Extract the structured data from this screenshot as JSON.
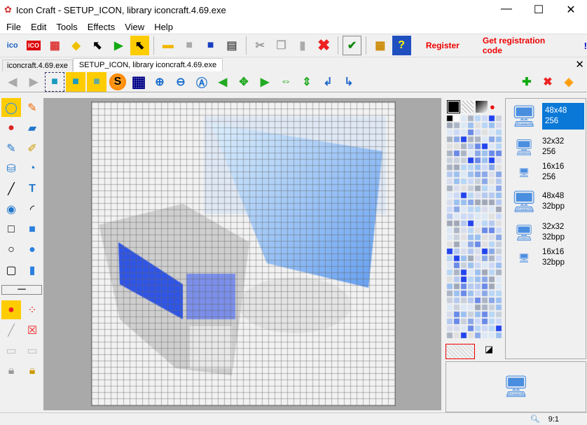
{
  "window": {
    "title": "Icon Craft - SETUP_ICON, library iconcraft.4.69.exe",
    "minimize": "—",
    "maximize": "☐",
    "close": "✕"
  },
  "menu": [
    "File",
    "Edit",
    "Tools",
    "Effects",
    "View",
    "Help"
  ],
  "toolbar": {
    "register": "Register",
    "get_code": "Get registration code",
    "extra": "!"
  },
  "tabs": [
    "iconcraft.4.69.exe",
    "SETUP_ICON, library iconcraft.4.69.exe"
  ],
  "tabs_close": "✕",
  "sizes": [
    {
      "dim": "48x48",
      "depth": "256",
      "selected": true
    },
    {
      "dim": "32x32",
      "depth": "256"
    },
    {
      "dim": "16x16",
      "depth": "256"
    },
    {
      "dim": "48x48",
      "depth": "32bpp"
    },
    {
      "dim": "32x32",
      "depth": "32bpp"
    },
    {
      "dim": "16x16",
      "depth": "32bpp"
    }
  ],
  "status": {
    "zoom": "9:1"
  },
  "colors": {
    "accent": "#0a78d7",
    "register": "#ee0000"
  }
}
